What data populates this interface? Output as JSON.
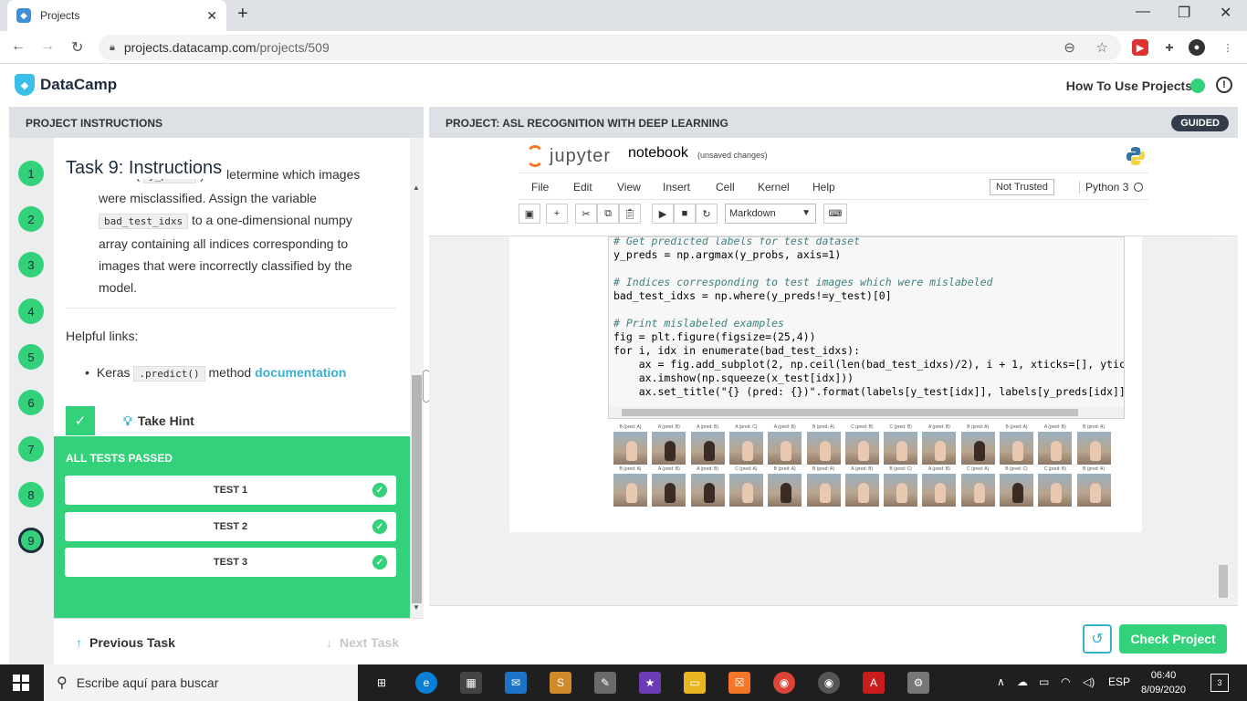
{
  "browser": {
    "tab_title": "Projects",
    "tab_close": "✕",
    "new_tab": "+",
    "url_host": "projects.datacamp.com",
    "url_path": "/projects/509"
  },
  "header": {
    "brand": "DataCamp",
    "how_to": "How To Use Projects"
  },
  "left": {
    "section_title": "PROJECT INSTRUCTIONS",
    "steps": [
      "1",
      "2",
      "3",
      "4",
      "5",
      "6",
      "7",
      "8",
      "9"
    ],
    "task_title": "Task 9: Instructions",
    "instr_line0_pre": "labels (",
    "instr_line0_code": "y_preds",
    "instr_line0_post": ") to determine which images",
    "instr_line1": "were misclassified. Assign the variable",
    "instr_code": "bad_test_idxs",
    "instr_line2_post": "to a one-dimensional numpy",
    "instr_line3": "array containing all indices corresponding to",
    "instr_line4": "images that were incorrectly classified by the",
    "instr_line5": "model.",
    "helpful": "Helpful links:",
    "link_pre": "Keras",
    "link_code": ".predict()",
    "link_mid": "method",
    "link_text": "documentation",
    "take_hint": "Take Hint",
    "tests_header": "ALL TESTS PASSED",
    "tests": [
      "TEST 1",
      "TEST 2",
      "TEST 3"
    ],
    "prev_task": "Previous Task",
    "next_task": "Next Task"
  },
  "right": {
    "section_title": "PROJECT: ASL RECOGNITION WITH DEEP LEARNING",
    "badge": "GUIDED",
    "jupyter": "jupyter",
    "notebook": "notebook",
    "unsaved": "(unsaved changes)",
    "menus": [
      "File",
      "Edit",
      "View",
      "Insert",
      "Cell",
      "Kernel",
      "Help"
    ],
    "not_trusted": "Not Trusted",
    "kernel": "Python 3",
    "cell_type": "Markdown",
    "code_lines": [
      "# Get predicted labels for test dataset",
      "y_preds = np.argmax(y_probs, axis=1)",
      "",
      "# Indices corresponding to test images which were mislabeled",
      "bad_test_idxs = np.where(y_preds!=y_test)[0]",
      "",
      "# Print mislabeled examples",
      "fig = plt.figure(figsize=(25,4))",
      "for i, idx in enumerate(bad_test_idxs):",
      "    ax = fig.add_subplot(2, np.ceil(len(bad_test_idxs)/2), i + 1, xticks=[], ytic",
      "    ax.imshow(np.squeeze(x_test[idx]))",
      "    ax.set_title(\"{} (pred: {})\".format(labels[y_test[idx]], labels[y_preds[idx]]"
    ],
    "image_labels_row1": [
      "B (pred: A)",
      "A (pred: B)",
      "A (pred: B)",
      "A (pred: C)",
      "A (pred: B)",
      "B (pred: A)",
      "C (pred: B)",
      "C (pred: B)",
      "A (pred: B)",
      "B (pred: A)",
      "B (pred: A)",
      "A (pred: B)",
      "B (pred: A)"
    ],
    "image_labels_row2": [
      "B (pred: A)",
      "A (pred: B)",
      "A (pred: B)",
      "C (pred: A)",
      "B (pred: A)",
      "B (pred: A)",
      "A (pred: B)",
      "B (pred: C)",
      "A (pred: B)",
      "C (pred: A)",
      "B (pred: C)",
      "C (pred: B)",
      "B (pred: A)"
    ],
    "check_project": "Check Project"
  },
  "taskbar": {
    "search_placeholder": "Escribe aquí para buscar",
    "lang": "ESP",
    "time": "06:40",
    "date": "8/09/2020",
    "notifications": "3"
  },
  "colors": {
    "accent_green": "#33d17a",
    "accent_blue": "#3ab0d0",
    "navy": "#1f2c3c"
  }
}
